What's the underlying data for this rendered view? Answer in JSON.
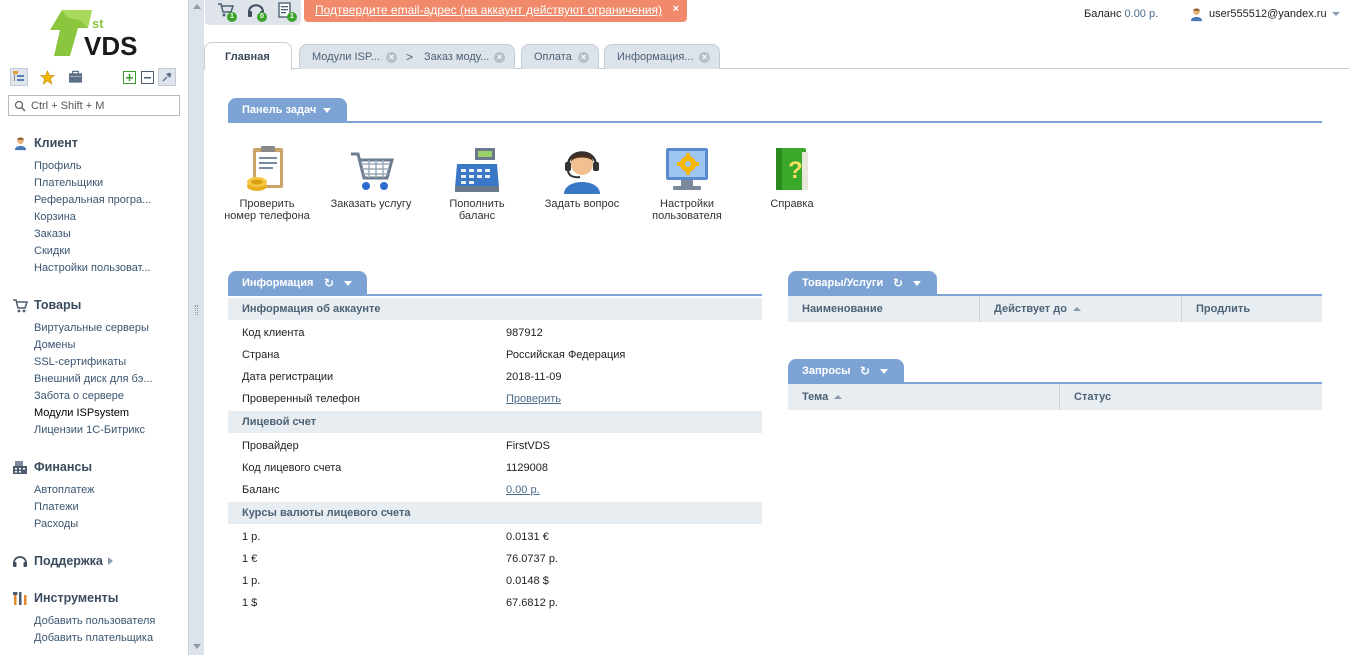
{
  "logo": {
    "sup": "st",
    "text": "VDS"
  },
  "sidebar": {
    "search_placeholder": "Ctrl + Shift + M",
    "groups": [
      {
        "title": "Клиент",
        "icon": "user-icon",
        "items": [
          "Профиль",
          "Плательщики",
          "Реферальная програ...",
          "Корзина",
          "Заказы",
          "Скидки",
          "Настройки пользоват..."
        ]
      },
      {
        "title": "Товары",
        "icon": "cart-icon",
        "items": [
          "Виртуальные серверы",
          "Домены",
          "SSL-сертификаты",
          "Внешний диск для бэ...",
          "Забота о сервере",
          "Модули ISPsystem",
          "Лицензии 1С-Битрикс"
        ]
      },
      {
        "title": "Финансы",
        "icon": "cash-register-icon",
        "items": [
          "Автоплатеж",
          "Платежи",
          "Расходы"
        ]
      },
      {
        "title": "Поддержка",
        "icon": "headset-icon",
        "items": []
      },
      {
        "title": "Инструменты",
        "icon": "tools-icon",
        "items": [
          "Добавить пользователя",
          "Добавить плательщика"
        ]
      }
    ]
  },
  "topbar": {
    "badges": {
      "cart": "1",
      "support": "0",
      "docs": "1"
    },
    "notice": "Подтвердите email-адрес (на аккаунт действуют ограничения)",
    "notice_close": "×",
    "balance_label": "Баланс",
    "balance_value": "0.00 р.",
    "username": "user555512@yandex.ru"
  },
  "tabs": {
    "main": "Главная",
    "modules": "Модули ISP...",
    "sep": ">",
    "order": "Заказ моду...",
    "payment": "Оплата",
    "info": "Информация...",
    "close": "×"
  },
  "taskbar": {
    "title": "Панель задач",
    "items": [
      "Проверить номер телефона",
      "Заказать услугу",
      "Пополнить баланс",
      "Задать вопрос",
      "Настройки пользователя",
      "Справка"
    ]
  },
  "info": {
    "title": "Информация",
    "refresh": "↻",
    "sections": {
      "account": "Информация об аккаунте",
      "ledger": "Лицевой счет",
      "rates": "Курсы валюты лицевого счета"
    },
    "account_rows": [
      {
        "k": "Код клиента",
        "v": "987912"
      },
      {
        "k": "Страна",
        "v": "Российская Федерация"
      },
      {
        "k": "Дата регистрации",
        "v": "2018-11-09"
      },
      {
        "k": "Проверенный телефон",
        "v": "Проверить"
      }
    ],
    "ledger_rows": [
      {
        "k": "Провайдер",
        "v": "FirstVDS"
      },
      {
        "k": "Код лицевого счета",
        "v": "1129008"
      },
      {
        "k": "Баланс",
        "v": "0.00 р."
      }
    ],
    "rate_rows": [
      {
        "k": "1 р.",
        "v": "0.0131 €"
      },
      {
        "k": "1 €",
        "v": "76.0737 р."
      },
      {
        "k": "1 р.",
        "v": "0.0148 $"
      },
      {
        "k": "1 $",
        "v": "67.6812 р."
      }
    ]
  },
  "goods": {
    "title": "Товары/Услуги",
    "refresh": "↻",
    "columns": [
      "Наименование",
      "Действует до",
      "Продлить"
    ]
  },
  "requests": {
    "title": "Запросы",
    "refresh": "↻",
    "columns": [
      "Тема",
      "Статус"
    ]
  }
}
